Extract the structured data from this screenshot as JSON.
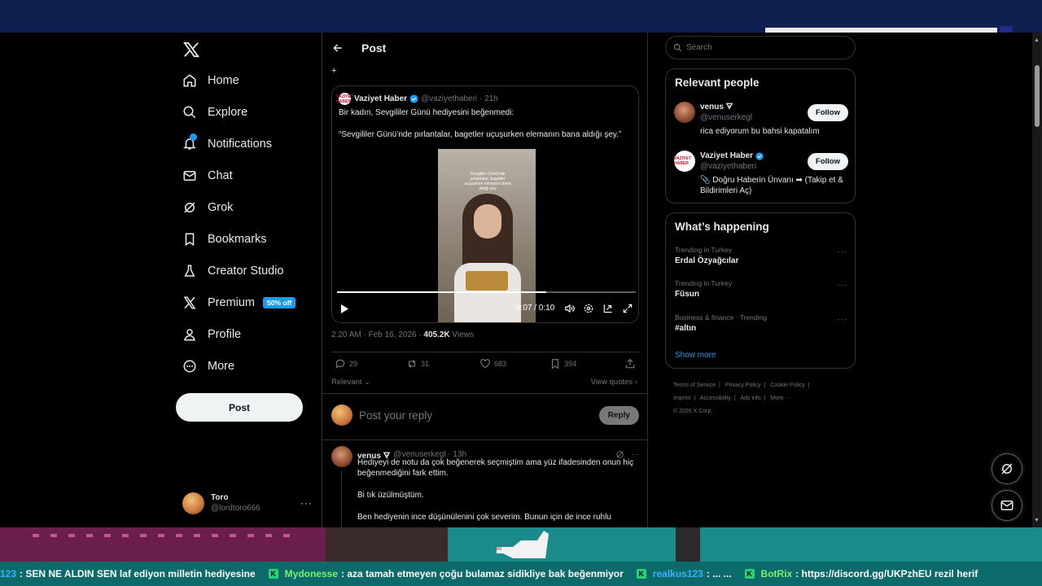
{
  "nav": {
    "items": [
      {
        "label": "Home",
        "icon": "home-icon"
      },
      {
        "label": "Explore",
        "icon": "search-icon"
      },
      {
        "label": "Notifications",
        "icon": "bell-icon"
      },
      {
        "label": "Chat",
        "icon": "mail-icon"
      },
      {
        "label": "Grok",
        "icon": "grok-icon"
      },
      {
        "label": "Bookmarks",
        "icon": "bookmark-icon"
      },
      {
        "label": "Creator Studio",
        "icon": "flask-icon"
      },
      {
        "label": "Premium",
        "icon": "x-logo-icon"
      },
      {
        "label": "Profile",
        "icon": "person-icon"
      },
      {
        "label": "More",
        "icon": "more-circle-icon"
      }
    ],
    "premium_badge": "50% off",
    "post_button": "Post"
  },
  "account": {
    "name": "Toro",
    "handle": "@lordtoro666",
    "more": "···"
  },
  "header": {
    "title": "Post"
  },
  "quoted": {
    "plus": "+",
    "avatar_text": "VAZIYET HABER",
    "name": "Vaziyet Haber",
    "handle": "@vaziyethaberi · 21h",
    "text1": "Bir kadın, Sevgililer Günü hediyesini beğenmedi:",
    "text2": "“Sevgililer Günü’nde pırlantalar, bagetler uçuşurken elemanın bana aldığı şey.”",
    "video_caption": "Sevgililer Günü'nde pırlantalar, bagetler uçuşurken elemanın bana aldığı şey",
    "time": "0:07 / 0:10",
    "progress": 0.7
  },
  "meta": {
    "timestamp": "2:20 AM · Feb 16, 2026 · ",
    "views": "405.2K",
    "views_label": " Views"
  },
  "actions": {
    "replies": "29",
    "reposts": "31",
    "likes": "683",
    "bookmarks": "394"
  },
  "sort": {
    "relevant": "Relevant",
    "view_quotes": "View quotes"
  },
  "reply": {
    "placeholder": "Post your reply",
    "button": "Reply"
  },
  "comment": {
    "name": "venus 🜃",
    "handle": "@venuserkegl · 13h",
    "p1": "Hediyeyi de notu da çok beğenerek seçmiştim ama yüz ifadesinden onun hiç beğenmediğini fark ettim.",
    "p2": "Bi tık üzülmüştüm.",
    "p3": "Ben hediyenin ince düşünülenini çok severim. Bunun için de ince ruhlu"
  },
  "search": {
    "placeholder": "Search"
  },
  "relevant_people": {
    "title": "Relevant people",
    "people": [
      {
        "name": "venus 🜃",
        "handle": "@venuserkegl",
        "bio": "rica ediyorum bu bahsi kapatalım",
        "follow": "Follow"
      },
      {
        "name": "Vaziyet Haber",
        "handle": "@vaziyethaberi",
        "bio": "📎 Doğru Haberin Ünvanı ➡ (Takip et & Bildirimleri Aç)",
        "follow": "Follow"
      }
    ]
  },
  "happening": {
    "title": "What’s happening",
    "trends": [
      {
        "category": "Trending in Turkey",
        "name": "Erdal Özyağcılar"
      },
      {
        "category": "Trending in Turkey",
        "name": "Füsun"
      },
      {
        "category": "Business & finance · Trending",
        "name": "#altın"
      }
    ],
    "show_more": "Show more"
  },
  "footer": {
    "links": [
      "Terms of Service",
      "|",
      "Privacy Policy",
      "|",
      "Cookie Policy",
      "|",
      "Imprint",
      "|",
      "Accessibility",
      "|",
      "Ads info",
      "|",
      "More ···"
    ],
    "copyright": "© 2026 X Corp."
  },
  "stream_chat": {
    "messages": [
      {
        "user": "123",
        "text": ": SEN NE ALDIN  SEN  laf ediyon milletin  hediyesine"
      },
      {
        "user": "Mydonesse",
        "text": ":  aza tamah etmeyen çoğu bulamaz sidikliye bak beğenmiyor"
      },
      {
        "user": "realkus123",
        "text": ": ...  ..."
      },
      {
        "user": "BotRix",
        "text": ":  https://discord.gg/UKPzhEU  rezil herif"
      }
    ]
  },
  "colors": {
    "accent": "#1d9bf0",
    "bg": "#000000",
    "border": "#2f3336",
    "muted": "#71767b"
  }
}
